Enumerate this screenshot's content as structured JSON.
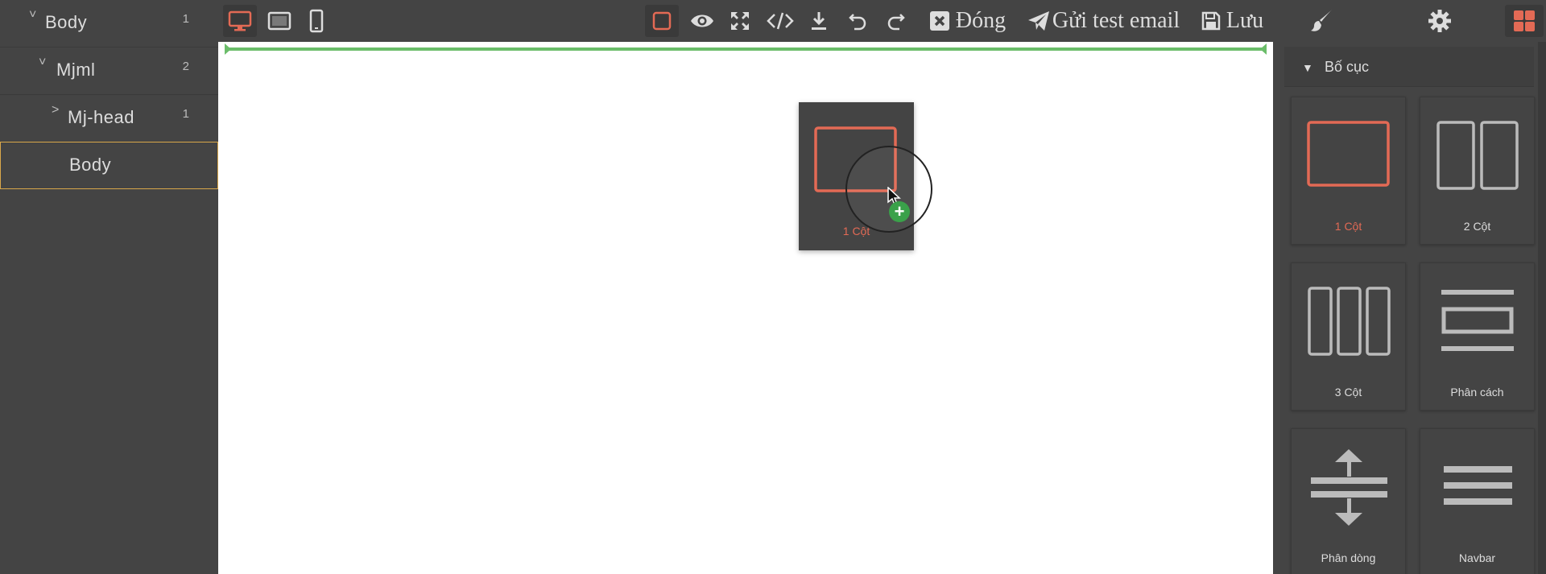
{
  "layers": [
    {
      "name": "Body",
      "count": "1",
      "caret": "˅"
    },
    {
      "name": "Mjml",
      "count": "2",
      "caret": "˅"
    },
    {
      "name": "Mj-head",
      "count": "1",
      "caret": "˃"
    },
    {
      "name": "Body",
      "count": "",
      "caret": ""
    }
  ],
  "toolbar": {
    "close_label": "Đóng",
    "send_test_label": "Gửi test email",
    "save_label": "Lưu"
  },
  "drag_ghost": {
    "label": "1 Cột"
  },
  "panel": {
    "category": "Bố cục",
    "blocks": [
      {
        "label": "1 Cột"
      },
      {
        "label": "2 Cột"
      },
      {
        "label": "3 Cột"
      },
      {
        "label": "Phân cách"
      },
      {
        "label": "Phân dòng"
      },
      {
        "label": "Navbar"
      }
    ]
  },
  "colors": {
    "accent": "#e36a55",
    "drop_indicator": "#6bbd6a",
    "selection_border": "#d9a74a",
    "add_badge": "#3aa14a",
    "panel_bg": "#444444"
  }
}
